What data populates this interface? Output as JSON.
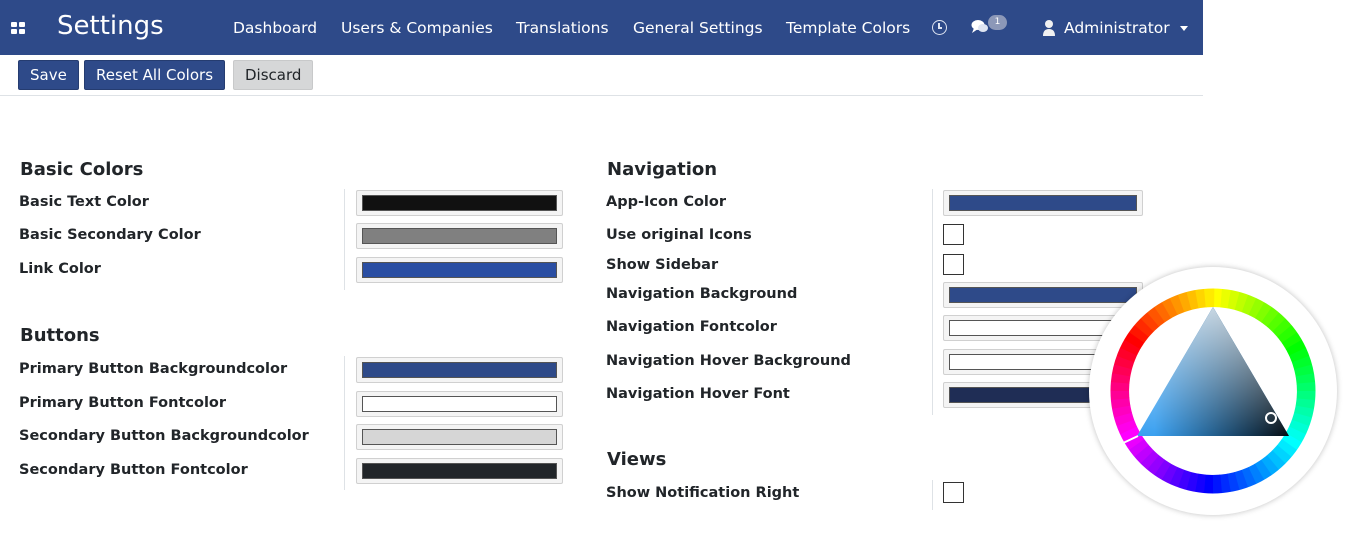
{
  "app": {
    "title": "Settings"
  },
  "nav": {
    "items": [
      "Dashboard",
      "Users & Companies",
      "Translations",
      "General Settings",
      "Template Colors"
    ],
    "chat_count": "1",
    "user": "Administrator"
  },
  "toolbar": {
    "save": "Save",
    "reset": "Reset All Colors",
    "discard": "Discard"
  },
  "sections": {
    "basic": {
      "title": "Basic Colors",
      "fields": [
        {
          "label": "Basic Text Color",
          "color": "#111111"
        },
        {
          "label": "Basic Secondary Color",
          "color": "#808080"
        },
        {
          "label": "Link Color",
          "color": "#2a4ea3"
        }
      ]
    },
    "buttons": {
      "title": "Buttons",
      "fields": [
        {
          "label": "Primary Button Backgroundcolor",
          "color": "#2e4a89"
        },
        {
          "label": "Primary Button Fontcolor",
          "color": "#ffffff"
        },
        {
          "label": "Secondary Button Backgroundcolor",
          "color": "#d6d6d6"
        },
        {
          "label": "Secondary Button Fontcolor",
          "color": "#212529"
        }
      ]
    },
    "navigation": {
      "title": "Navigation",
      "fields": [
        {
          "label": "App-Icon Color",
          "type": "color",
          "color": "#2e4a89"
        },
        {
          "label": "Use original Icons",
          "type": "checkbox",
          "checked": false
        },
        {
          "label": "Show Sidebar",
          "type": "checkbox",
          "checked": false
        },
        {
          "label": "Navigation Background",
          "type": "color",
          "color": "#2e4a89"
        },
        {
          "label": "Navigation Fontcolor",
          "type": "color",
          "color": "#ffffff"
        },
        {
          "label": "Navigation Hover Background",
          "type": "color",
          "color": "#ffffff"
        },
        {
          "label": "Navigation Hover Font",
          "type": "color",
          "color": "#1f2d55"
        }
      ]
    },
    "views": {
      "title": "Views",
      "fields": [
        {
          "label": "Show Notification Right",
          "type": "checkbox",
          "checked": false
        }
      ]
    }
  },
  "colors": {
    "navbar": "#2e4a89",
    "primary": "#2e4a89",
    "secondary": "#d6d7d8"
  }
}
